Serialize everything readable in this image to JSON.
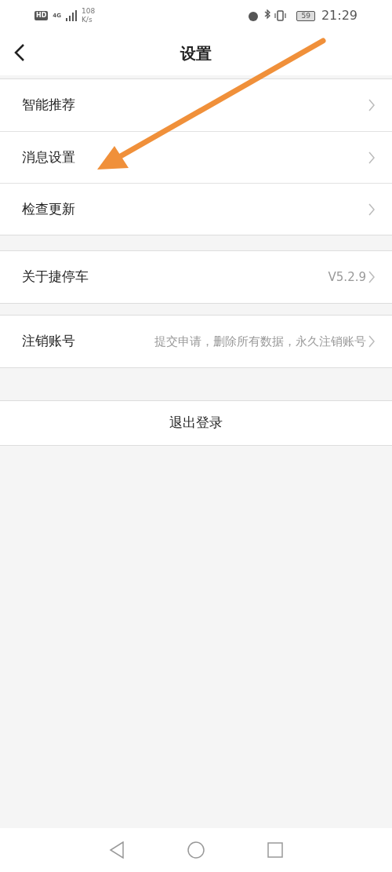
{
  "status_bar": {
    "hd": "HD",
    "network": "4G",
    "speed": "108",
    "speed_unit": "K/s",
    "battery": "59",
    "time": "21:29"
  },
  "header": {
    "title": "设置"
  },
  "groups": [
    {
      "items": [
        {
          "label": "智能推荐"
        },
        {
          "label": "消息设置"
        },
        {
          "label": "检查更新"
        }
      ]
    },
    {
      "items": [
        {
          "label": "关于捷停车",
          "value": "V5.2.9"
        }
      ]
    },
    {
      "items": [
        {
          "label": "注销账号",
          "value": "提交申请，删除所有数据，永久注销账号"
        }
      ]
    }
  ],
  "logout_button": {
    "label": "退出登录"
  }
}
